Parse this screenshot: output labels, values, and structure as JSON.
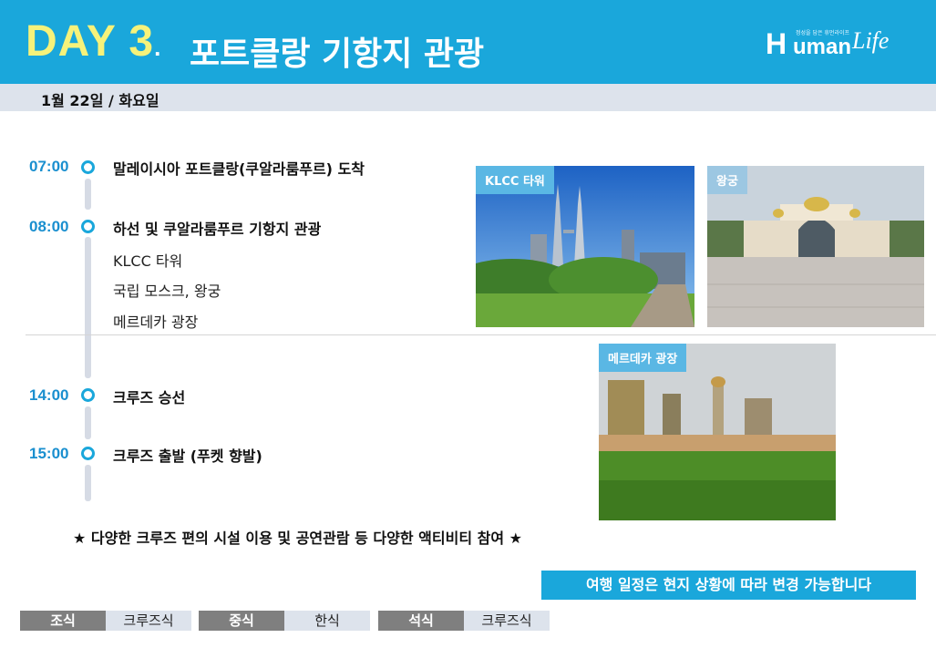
{
  "header": {
    "day_label": "DAY 3",
    "day_dot": ".",
    "title": "포트클랑 기항지 관광",
    "logo": {
      "mark": "H",
      "name": "uman",
      "script": "Life",
      "tagline": "정성을 담은 휴먼라이프"
    }
  },
  "date": "1월 22일 / 화요일",
  "schedule": [
    {
      "time": "07:00",
      "event": "말레이시아 포트클랑(쿠알라룸푸르) 도착",
      "details": []
    },
    {
      "time": "08:00",
      "event": "하선 및 쿠알라룸푸르 기항지 관광",
      "details": [
        "KLCC 타워",
        "국립 모스크, 왕궁",
        "메르데카 광장"
      ]
    },
    {
      "time": "14:00",
      "event": "크루즈 승선",
      "details": []
    },
    {
      "time": "15:00",
      "event": "크루즈 출발 (푸켓 향발)",
      "details": []
    }
  ],
  "photos": [
    {
      "caption": "KLCC 타워"
    },
    {
      "caption": "왕궁"
    },
    {
      "caption": "메르데카 광장"
    }
  ],
  "note": "★ 다양한 크루즈 편의 시설 이용 및 공연관람 등 다양한 액티비티 참여 ★",
  "notice": "여행 일정은 현지 상황에 따라 변경 가능합니다",
  "meals": [
    {
      "label": "조식",
      "value": "크루즈식"
    },
    {
      "label": "중식",
      "value": "한식"
    },
    {
      "label": "석식",
      "value": "크루즈식"
    }
  ],
  "colors": {
    "accent": "#1aa7db",
    "day_yellow": "#f6f27a",
    "bar_gray": "#dde3ec",
    "meal_dark": "#7f7f7f",
    "time_blue": "#1a8fcf"
  }
}
